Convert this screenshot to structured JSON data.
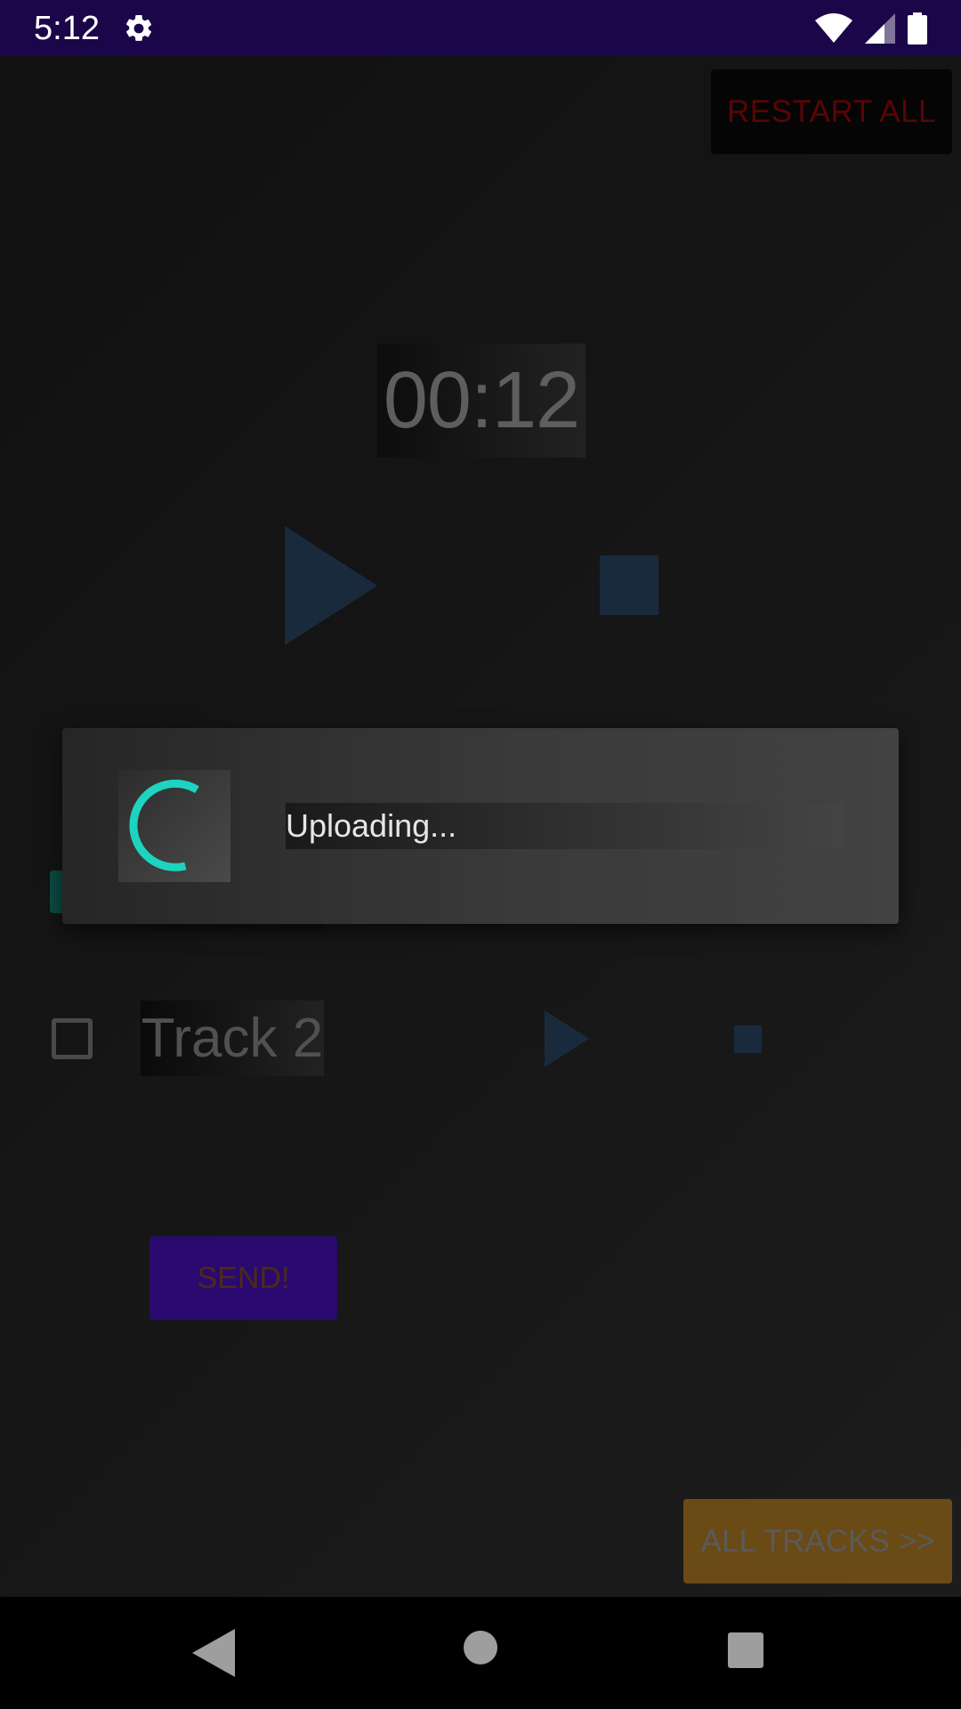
{
  "status_bar": {
    "time": "5:12",
    "icons": [
      "gear-icon",
      "wifi-icon",
      "signal-icon",
      "battery-icon"
    ]
  },
  "app": {
    "restart_label": "RESTART ALL",
    "timer": "00:12",
    "tracks": [
      {
        "label": "Track 2",
        "checked": false
      }
    ],
    "send_label": "SEND!",
    "all_tracks_label": "ALL TRACKS >>"
  },
  "dialog": {
    "message": "Uploading..."
  },
  "colors": {
    "status_bar": "#1a0648",
    "accent_spinner": "#1ed3c0",
    "play_blue": "#1a2a3d",
    "send_purple": "#2a0a6e",
    "all_tracks_gold": "#6a4a15"
  },
  "nav_bar": {
    "icons": [
      "back-icon",
      "home-icon",
      "recents-icon"
    ]
  }
}
